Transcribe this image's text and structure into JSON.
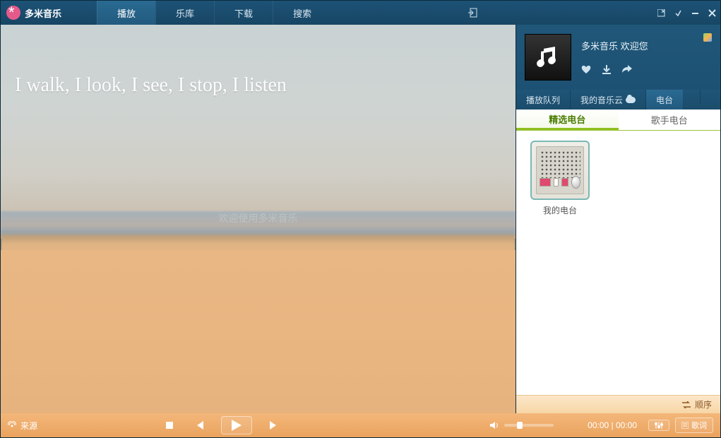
{
  "app_title": "多米音乐",
  "nav": {
    "play": "播放",
    "library": "乐库",
    "download": "下载",
    "search": "搜索"
  },
  "visual": {
    "motto": "I walk, I look, I see, I stop, I listen",
    "welcome": "欢迎使用多米音乐"
  },
  "nowplay": {
    "greeting": "多米音乐  欢迎您"
  },
  "side_tabs": {
    "queue": "播放队列",
    "mycloud": "我的音乐云",
    "radio": "电台"
  },
  "subtabs": {
    "featured": "精选电台",
    "artist": "歌手电台"
  },
  "radio": {
    "my_radio": "我的电台"
  },
  "order_label": "顺序",
  "player": {
    "source": "来源",
    "time_current": "00:00",
    "time_total": "00:00",
    "lyrics": "歌词"
  }
}
